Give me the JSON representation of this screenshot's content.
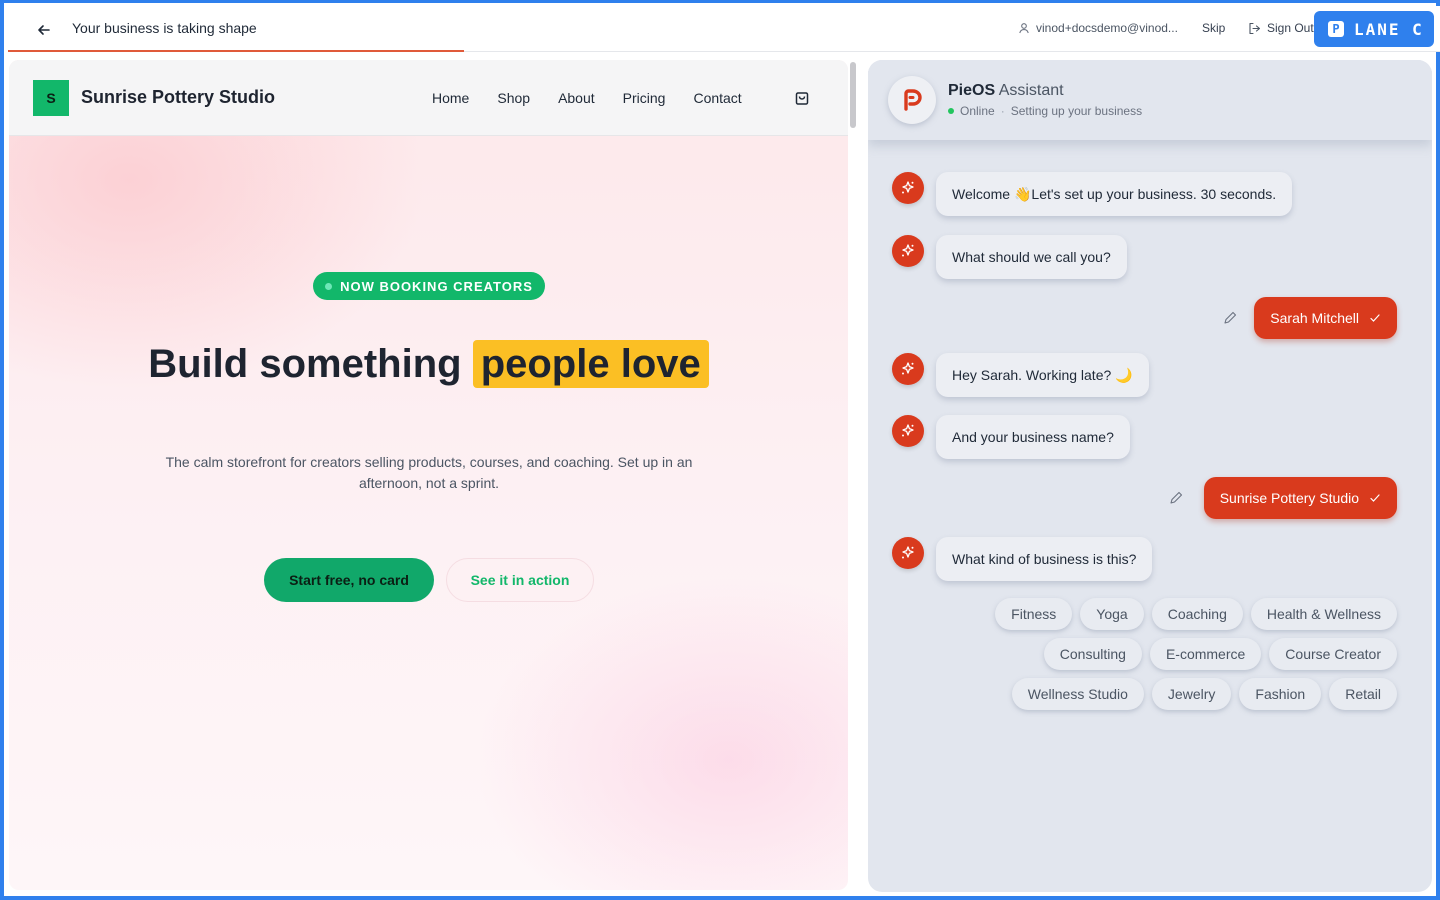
{
  "topbar": {
    "title": "Your business is taking shape",
    "user_email": "vinod+docsdemo@vinod...",
    "skip_label": "Skip",
    "signout_label": "Sign Out",
    "badge_letter": "P",
    "badge_label": "LANE C",
    "progress_color": "#e05a3a"
  },
  "site": {
    "logo_letter": "S",
    "name": "Sunrise Pottery Studio",
    "nav": [
      "Home",
      "Shop",
      "About",
      "Pricing",
      "Contact"
    ],
    "pill": "NOW BOOKING CREATORS",
    "hero_title_plain": "Build something",
    "hero_title_highlight": "people love",
    "hero_subtitle": "The calm storefront for creators selling products, courses, and coaching. Set up in an afternoon, not a sprint.",
    "cta_primary": "Start free, no card",
    "cta_secondary": "See it in action",
    "accent_color": "#12b76a",
    "highlight_color": "#fbbf24"
  },
  "chat": {
    "assistant_brand": "PieOS",
    "assistant_rest": "Assistant",
    "status": "Online",
    "status_detail": "Setting up your business",
    "messages": [
      {
        "from": "bot",
        "text": "Welcome 👋Let's set up your business. 30 seconds."
      },
      {
        "from": "bot",
        "text": "What should we call you?"
      },
      {
        "from": "user",
        "text": "Sarah Mitchell"
      },
      {
        "from": "bot",
        "text": "Hey Sarah. Working late? 🌙"
      },
      {
        "from": "bot",
        "text": "And your business name?"
      },
      {
        "from": "user",
        "text": "Sunrise Pottery Studio"
      },
      {
        "from": "bot",
        "text": "What kind of business is this?"
      }
    ],
    "options": [
      "Fitness",
      "Yoga",
      "Coaching",
      "Health & Wellness",
      "Consulting",
      "E-commerce",
      "Course Creator",
      "Wellness Studio",
      "Jewelry",
      "Fashion",
      "Retail"
    ],
    "brand_color": "#d93a1d"
  }
}
